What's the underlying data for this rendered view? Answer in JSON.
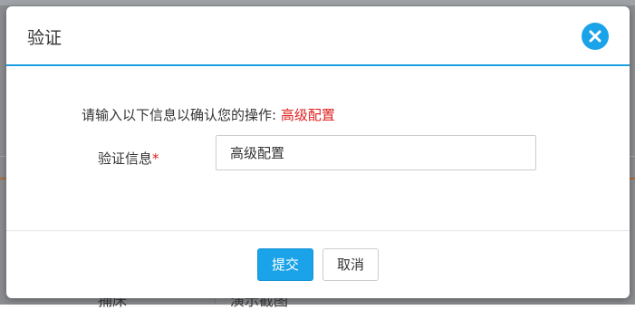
{
  "background": {
    "peek_left": "捕床",
    "peek_right": "演示截图"
  },
  "dialog": {
    "title": "验证",
    "prompt_text": "请输入以下信息以确认您的操作: ",
    "operation_name": "高级配置",
    "field_label": "验证信息",
    "required_mark": "*",
    "field_value": "高级配置",
    "submit_label": "提交",
    "cancel_label": "取消"
  },
  "colors": {
    "accent": "#1aa3e8",
    "danger": "#e0201e"
  },
  "icons": {
    "close": "close-icon"
  }
}
